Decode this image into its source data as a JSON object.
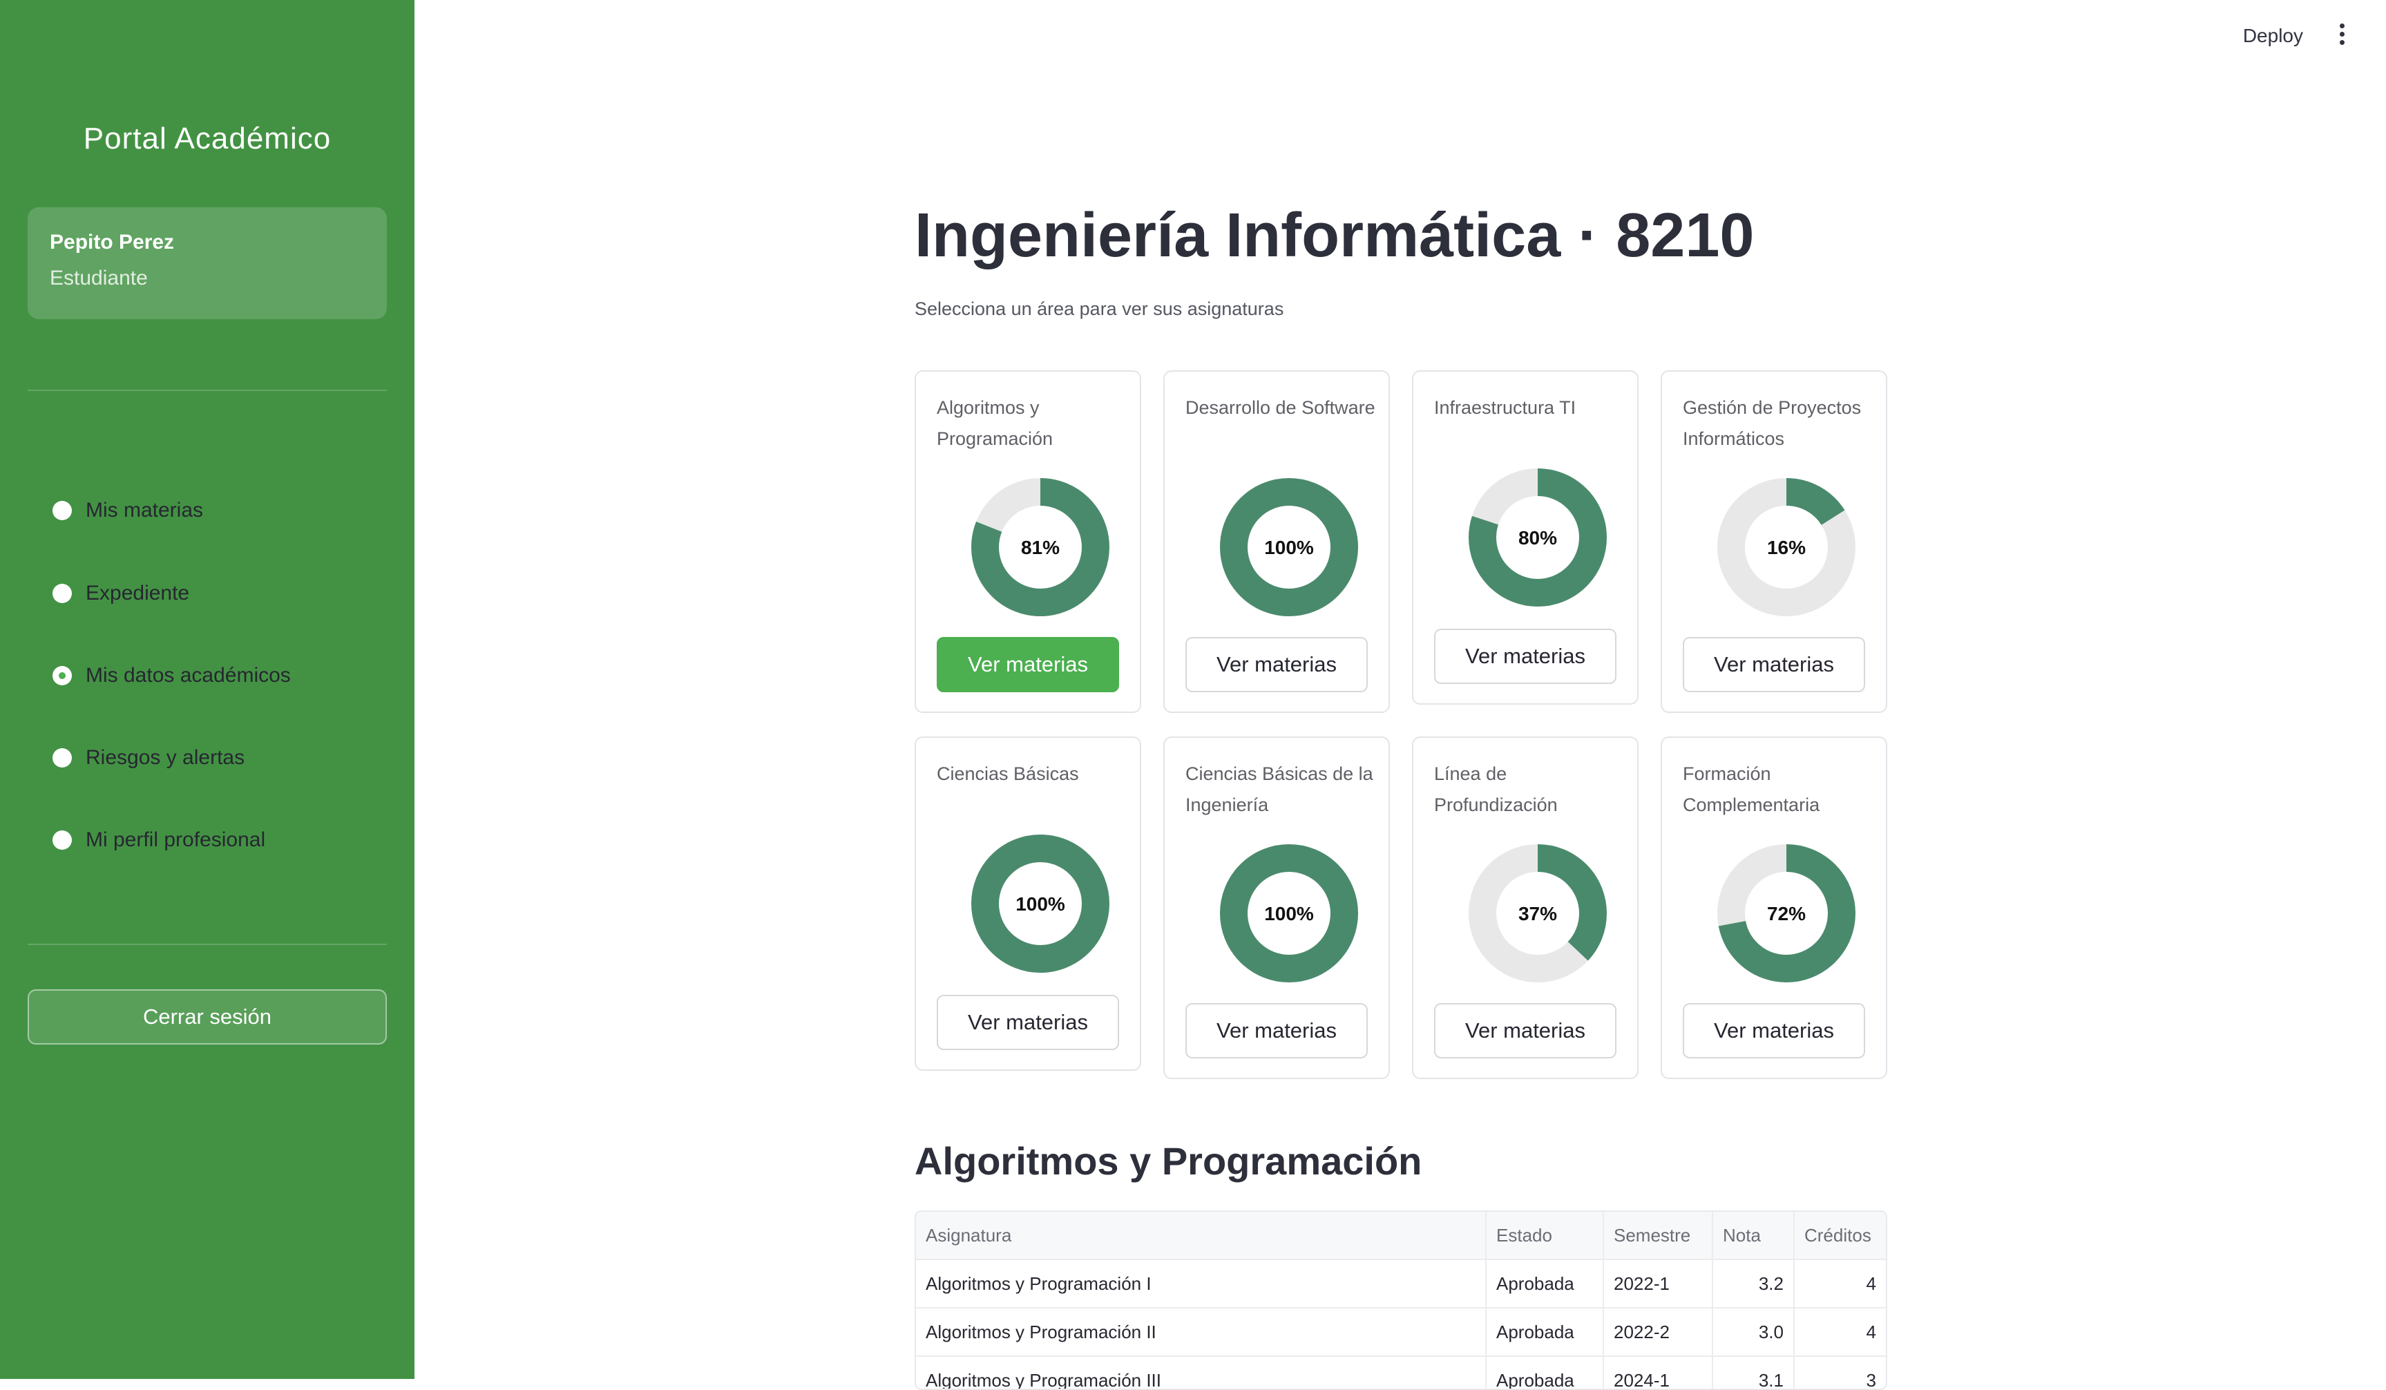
{
  "sidebar": {
    "brand": "Portal Académico",
    "user": {
      "name": "Pepito Perez",
      "role": "Estudiante"
    },
    "nav": [
      {
        "label": "Mis materias",
        "selected": false
      },
      {
        "label": "Expediente",
        "selected": false
      },
      {
        "label": "Mis datos académicos",
        "selected": true
      },
      {
        "label": "Riesgos y alertas",
        "selected": false
      },
      {
        "label": "Mi perfil profesional",
        "selected": false
      }
    ],
    "logout_label": "Cerrar sesión"
  },
  "topbar": {
    "deploy_label": "Deploy",
    "menu_icon": "more-vertical-icon"
  },
  "main": {
    "title": "Ingeniería Informática · 8210",
    "subtitle": "Selecciona un área para ver sus asignaturas",
    "button_label": "Ver materias",
    "areas": [
      {
        "name": "Algoritmos y Programación",
        "percent": 81,
        "percent_label": "81%",
        "active": true
      },
      {
        "name": "Desarrollo de Software",
        "percent": 100,
        "percent_label": "100%",
        "active": false
      },
      {
        "name": "Infraestructura TI",
        "percent": 80,
        "percent_label": "80%",
        "active": false
      },
      {
        "name": "Gestión de Proyectos Informáticos",
        "percent": 16,
        "percent_label": "16%",
        "active": false
      },
      {
        "name": "Ciencias Básicas",
        "percent": 100,
        "percent_label": "100%",
        "active": false
      },
      {
        "name": "Ciencias Básicas de la Ingeniería",
        "percent": 100,
        "percent_label": "100%",
        "active": false
      },
      {
        "name": "Línea de Profundización",
        "percent": 37,
        "percent_label": "37%",
        "active": false
      },
      {
        "name": "Formación Complementaria",
        "percent": 72,
        "percent_label": "72%",
        "active": false
      }
    ],
    "section_title": "Algoritmos y Programación",
    "table": {
      "columns": [
        "Asignatura",
        "Estado",
        "Semestre",
        "Nota",
        "Créditos"
      ],
      "rows": [
        [
          "Algoritmos y Programación I",
          "Aprobada",
          "2022-1",
          "3.2",
          "4"
        ],
        [
          "Algoritmos y Programación II",
          "Aprobada",
          "2022-2",
          "3.0",
          "4"
        ],
        [
          "Algoritmos y Programación III",
          "Aprobada",
          "2024-1",
          "3.1",
          "3"
        ]
      ]
    }
  },
  "colors": {
    "sidebar": "#439244",
    "donut_fill": "#4a8a6c",
    "donut_track": "#e8e8e8",
    "primary_button": "#4caf50"
  }
}
